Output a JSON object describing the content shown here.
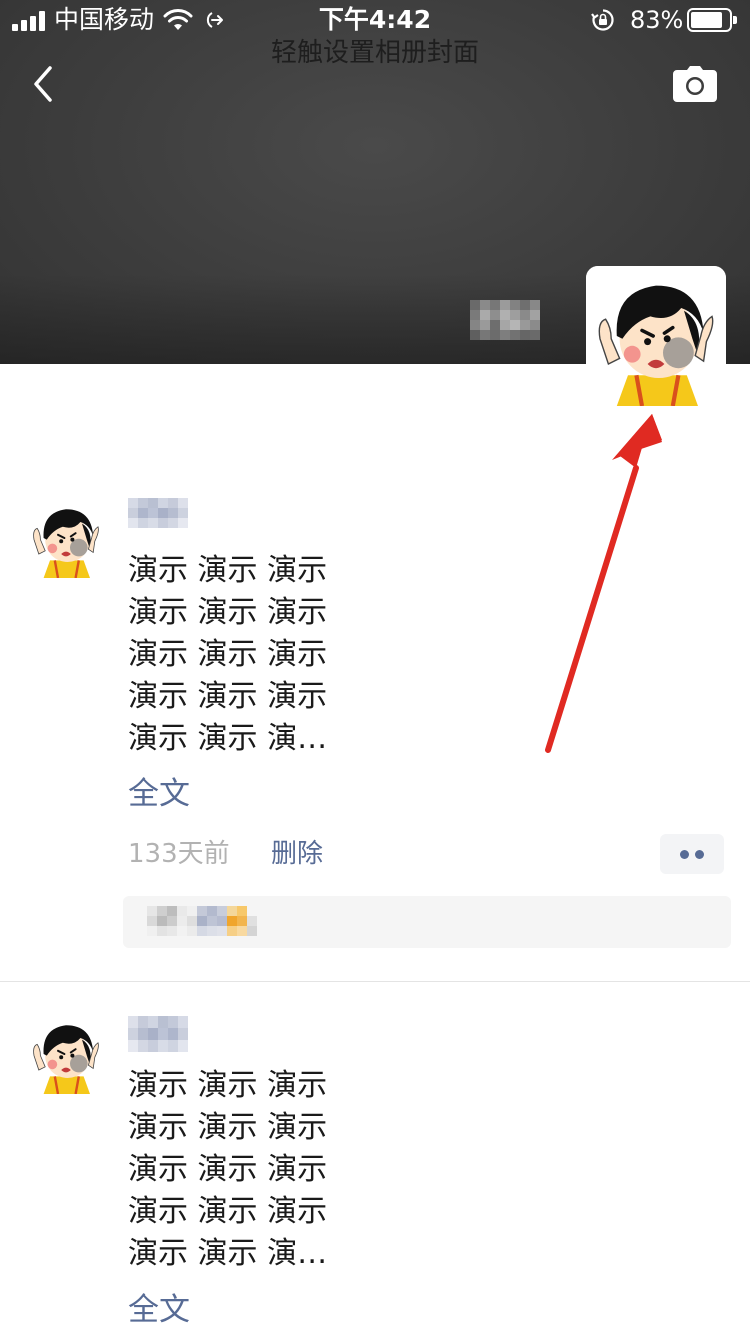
{
  "status_bar": {
    "carrier": "中国移动",
    "time": "下午4:42",
    "battery_percent": "83%",
    "battery_level": 0.83,
    "icons": [
      "signal-icon",
      "wifi-icon",
      "location-arrow-icon",
      "rotation-lock-icon",
      "battery-icon"
    ]
  },
  "header": {
    "cover_hint": "轻触设置相册封面",
    "back_icon": "chevron-left-icon",
    "camera_icon": "camera-icon"
  },
  "posts": [
    {
      "text": "演示 演示 演示\n演示 演示 演示\n演示 演示 演示\n演示 演示 演示\n演示 演示 演…",
      "full_text_label": "全文",
      "time": "133天前",
      "delete_label": "删除"
    },
    {
      "text": "演示 演示 演示\n演示 演示 演示\n演示 演示 演示\n演示 演示 演示\n演示 演示 演…",
      "full_text_label": "全文"
    }
  ],
  "colors": {
    "link": "#576b95",
    "cover": "#3d3d3d",
    "annotation_arrow": "#e02a22",
    "timestamp": "#b2b2b2"
  }
}
